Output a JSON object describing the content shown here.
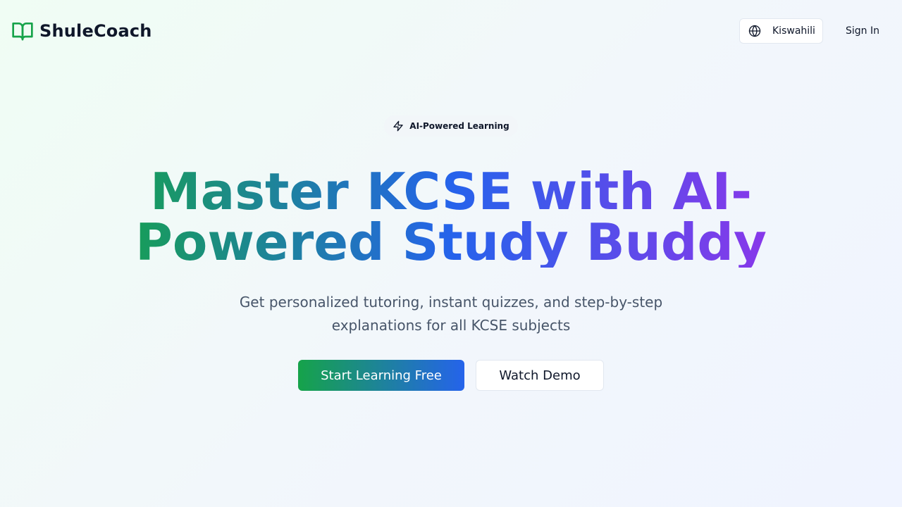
{
  "header": {
    "brand_name": "ShuleCoach",
    "brand_icon": "open-book-icon",
    "language_label": "Kiswahili",
    "language_icon": "globe-icon",
    "signin_label": "Sign In"
  },
  "hero": {
    "badge_label": "AI-Powered Learning",
    "badge_icon": "lightning-icon",
    "headline_line1": "Master KCSE with AI-",
    "headline_line2": "Powered Study Buddy",
    "subtitle_line1": "Get personalized tutoring, instant quizzes, and step-by-step",
    "subtitle_line2": "explanations for all KCSE subjects",
    "primary_cta": "Start Learning Free",
    "secondary_cta": "Watch Demo"
  },
  "colors": {
    "brand_green": "#16a34a",
    "brand_blue": "#2563eb",
    "brand_purple": "#9333ea"
  }
}
